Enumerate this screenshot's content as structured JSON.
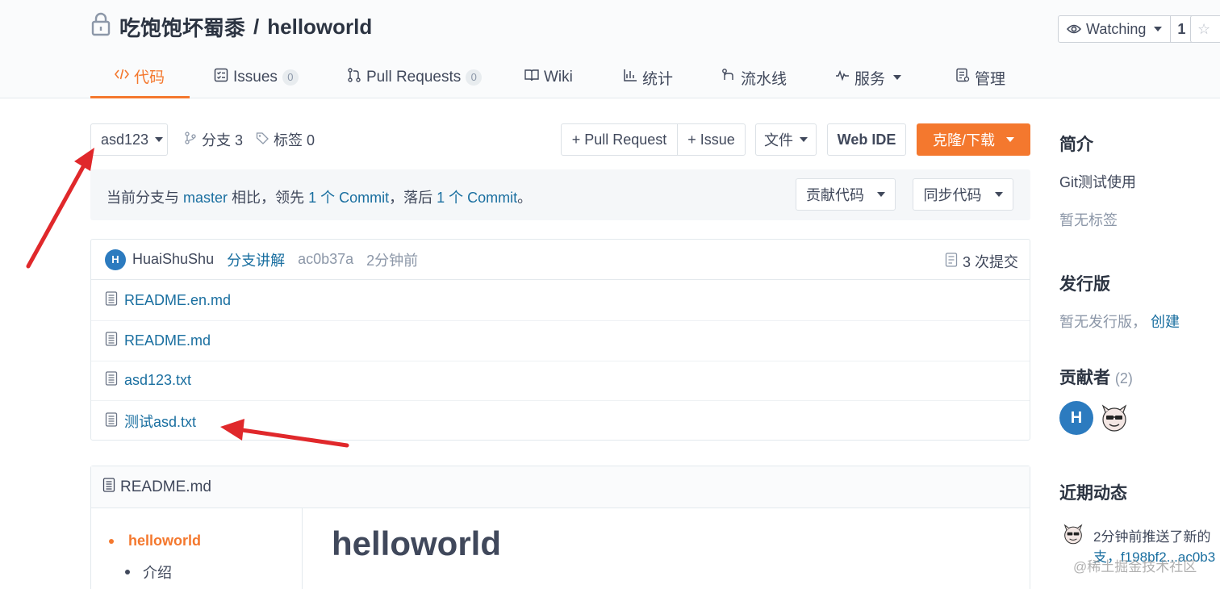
{
  "repo": {
    "owner": "吃饱饱坏蜀黍",
    "separator": "/",
    "name": "helloworld"
  },
  "watch": {
    "label": "Watching",
    "count": "1"
  },
  "tabs": [
    {
      "label": "代码",
      "icon": "code-icon",
      "active": true
    },
    {
      "label": "Issues",
      "icon": "issues-icon",
      "badge": "0"
    },
    {
      "label": "Pull Requests",
      "icon": "pull-request-icon",
      "badge": "0"
    },
    {
      "label": "Wiki",
      "icon": "wiki-icon"
    },
    {
      "label": "统计",
      "icon": "stats-icon"
    },
    {
      "label": "流水线",
      "icon": "pipeline-icon"
    },
    {
      "label": "服务",
      "icon": "service-icon",
      "dropdown": true
    },
    {
      "label": "管理",
      "icon": "manage-icon"
    }
  ],
  "toolbar": {
    "branch": "asd123",
    "branches_label": "分支 3",
    "tags_label": "标签 0",
    "pull_request_btn": "+ Pull Request",
    "issue_btn": "+ Issue",
    "file_btn": "文件",
    "webide_btn": "Web IDE",
    "clone_btn": "克隆/下载"
  },
  "compare": {
    "prefix": "当前分支与",
    "base": "master",
    "middle1": "相比，领先",
    "ahead": "1 个 Commit",
    "middle2": "，落后",
    "behind": "1 个 Commit",
    "suffix": "。",
    "contribute_btn": "贡献代码",
    "sync_btn": "同步代码"
  },
  "last_commit": {
    "avatar_letter": "H",
    "author": "HuaiShuShu",
    "message": "分支讲解",
    "sha": "ac0b37a",
    "time": "2分钟前",
    "count_label": "3 次提交"
  },
  "files": [
    {
      "name": "README.en.md"
    },
    {
      "name": "README.md"
    },
    {
      "name": "asd123.txt"
    },
    {
      "name": "测试asd.txt"
    }
  ],
  "readme": {
    "filename": "README.md",
    "toc": [
      "helloworld",
      "介绍"
    ],
    "heading": "helloworld"
  },
  "sidebar": {
    "intro_title": "简介",
    "intro_text": "Git测试使用",
    "no_tags": "暂无标签",
    "release_title": "发行版",
    "no_release": "暂无发行版，",
    "create_link": "创建",
    "contrib_title": "贡献者",
    "contrib_count": "(2)",
    "contrib_avatar_letter": "H",
    "activity_title": "近期动态",
    "activity_line1": "2分钟前推送了新的",
    "activity_line2": "支，f198bf2...ac0b3"
  },
  "watermark": "@稀土掘金技术社区",
  "colors": {
    "accent": "#f4782e",
    "link": "#1a6fa0",
    "annotation_arrow": "#e0282b"
  }
}
